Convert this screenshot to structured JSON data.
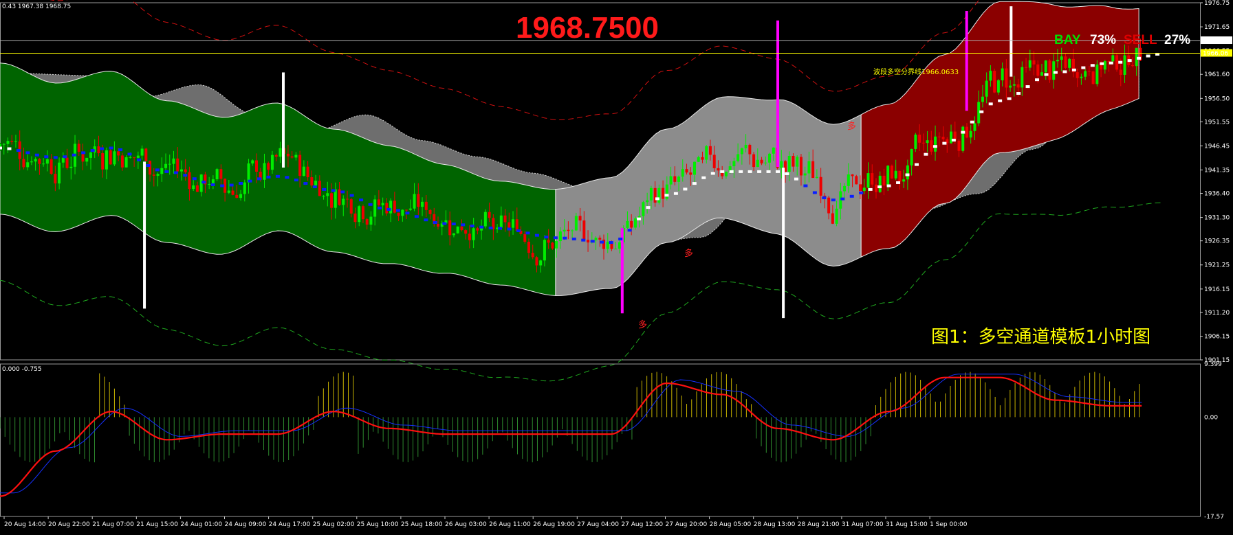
{
  "header": {
    "ohlc_readout": "0.43 1967.38 1968.75",
    "big_price": "1968.7500",
    "caption": "图1：多空通道模板1小时图"
  },
  "sentiment": {
    "bay_label": "BAY",
    "bay_value": "73%",
    "sell_label": "SELL",
    "sell_value": "27%",
    "bay_color": "#00e000",
    "sell_color": "#e00000"
  },
  "dividing_line": {
    "label": "波段多空分界线1966.0633",
    "price": 1966.06,
    "tag": "1966.06",
    "color": "#ffff00"
  },
  "current_price": {
    "price": 1968.75,
    "tag": "1968.75"
  },
  "signal_marks": {
    "text": "多",
    "color": "#ff2020"
  },
  "chart_data": [
    {
      "type": "line",
      "panel": "price",
      "y_axis_labels": [
        "1976.75",
        "1971.65",
        "1966.55",
        "1961.60",
        "1956.50",
        "1951.55",
        "1946.45",
        "1941.35",
        "1936.40",
        "1931.30",
        "1926.35",
        "1921.25",
        "1916.15",
        "1911.20",
        "1906.15",
        "1901.15"
      ],
      "ylim": [
        1901.15,
        1976.75
      ],
      "x_axis_labels": [
        "20 Aug 14:00",
        "20 Aug 22:00",
        "21 Aug 07:00",
        "21 Aug 15:00",
        "24 Aug 01:00",
        "24 Aug 09:00",
        "24 Aug 17:00",
        "25 Aug 02:00",
        "25 Aug 10:00",
        "25 Aug 18:00",
        "26 Aug 03:00",
        "26 Aug 11:00",
        "26 Aug 19:00",
        "27 Aug 04:00",
        "27 Aug 12:00",
        "27 Aug 20:00",
        "28 Aug 05:00",
        "28 Aug 13:00",
        "28 Aug 21:00",
        "31 Aug 07:00",
        "31 Aug 15:00",
        "1 Sep 00:00"
      ],
      "channel_segments": [
        {
          "from": 0,
          "to": 10,
          "color": "#006400"
        },
        {
          "from": 10,
          "to": 15.5,
          "color": "#8c8c8c"
        },
        {
          "from": 15.5,
          "to": 20.5,
          "color": "#8b0000"
        }
      ],
      "channel_center": [
        {
          "x": 0,
          "y": 1948
        },
        {
          "x": 1,
          "y": 1944
        },
        {
          "x": 2,
          "y": 1947
        },
        {
          "x": 3,
          "y": 1941
        },
        {
          "x": 4,
          "y": 1938
        },
        {
          "x": 5,
          "y": 1942
        },
        {
          "x": 6,
          "y": 1937
        },
        {
          "x": 7,
          "y": 1934
        },
        {
          "x": 8,
          "y": 1931
        },
        {
          "x": 9,
          "y": 1928
        },
        {
          "x": 10,
          "y": 1926
        },
        {
          "x": 11,
          "y": 1928
        },
        {
          "x": 12,
          "y": 1938
        },
        {
          "x": 13,
          "y": 1944
        },
        {
          "x": 14,
          "y": 1942
        },
        {
          "x": 15,
          "y": 1936
        },
        {
          "x": 16,
          "y": 1940
        },
        {
          "x": 17,
          "y": 1950
        },
        {
          "x": 18,
          "y": 1961
        },
        {
          "x": 19,
          "y": 1962
        },
        {
          "x": 20,
          "y": 1965
        },
        {
          "x": 21,
          "y": 1967
        }
      ],
      "channel_half_width": [
        {
          "x": 0,
          "y": 16
        },
        {
          "x": 3,
          "y": 15
        },
        {
          "x": 6,
          "y": 13
        },
        {
          "x": 9,
          "y": 11
        },
        {
          "x": 12,
          "y": 12
        },
        {
          "x": 15,
          "y": 15
        },
        {
          "x": 18,
          "y": 16
        },
        {
          "x": 21,
          "y": 9
        }
      ],
      "series": [
        {
          "values": [
            {
              "x": 0,
              "y": 1946
            },
            {
              "x": 1,
              "y": 1944
            },
            {
              "x": 2,
              "y": 1946
            },
            {
              "x": 3,
              "y": 1941
            },
            {
              "x": 4,
              "y": 1938
            },
            {
              "x": 5,
              "y": 1940
            },
            {
              "x": 6,
              "y": 1937
            },
            {
              "x": 7,
              "y": 1933
            },
            {
              "x": 8,
              "y": 1930
            },
            {
              "x": 9,
              "y": 1929
            },
            {
              "x": 10,
              "y": 1927
            },
            {
              "x": 11,
              "y": 1926
            },
            {
              "x": 12,
              "y": 1936
            },
            {
              "x": 13,
              "y": 1941
            },
            {
              "x": 14,
              "y": 1941
            },
            {
              "x": 15,
              "y": 1935
            },
            {
              "x": 16,
              "y": 1938
            },
            {
              "x": 17,
              "y": 1947
            },
            {
              "x": 18,
              "y": 1956
            },
            {
              "x": 19,
              "y": 1962
            },
            {
              "x": 20,
              "y": 1964
            },
            {
              "x": 21,
              "y": 1966
            }
          ]
        }
      ],
      "extreme_bars": [
        {
          "x": 2.6,
          "low": 1912,
          "color": "#ffffff"
        },
        {
          "x": 5.1,
          "high": 1962,
          "color": "#ffffff"
        },
        {
          "x": 11.2,
          "low": 1911,
          "color": "#ff00ff"
        },
        {
          "x": 14.0,
          "high": 1973,
          "color": "#ff00ff"
        },
        {
          "x": 14.1,
          "low": 1910,
          "color": "#ffffff"
        },
        {
          "x": 17.4,
          "high": 1975,
          "color": "#ff00ff"
        },
        {
          "x": 18.2,
          "high": 1976,
          "color": "#ffffff"
        }
      ]
    },
    {
      "type": "bar",
      "panel": "oscillator",
      "header": "0.000 -0.755",
      "y_axis_labels": [
        "9.399",
        "0.00",
        "-17.57"
      ],
      "ylim": [
        -17.57,
        9.399
      ],
      "series": [
        {
          "values": [
            {
              "x": 0,
              "y": -14
            },
            {
              "x": 1,
              "y": -6
            },
            {
              "x": 2,
              "y": 1
            },
            {
              "x": 3,
              "y": -4
            },
            {
              "x": 4,
              "y": -3
            },
            {
              "x": 5,
              "y": -3
            },
            {
              "x": 6,
              "y": 1
            },
            {
              "x": 7,
              "y": -2
            },
            {
              "x": 8,
              "y": -3
            },
            {
              "x": 9,
              "y": -3
            },
            {
              "x": 10,
              "y": -3
            },
            {
              "x": 11,
              "y": -3
            },
            {
              "x": 12,
              "y": 6
            },
            {
              "x": 13,
              "y": 4
            },
            {
              "x": 14,
              "y": -2
            },
            {
              "x": 15,
              "y": -4
            },
            {
              "x": 16,
              "y": 1
            },
            {
              "x": 17,
              "y": 7
            },
            {
              "x": 18,
              "y": 7
            },
            {
              "x": 19,
              "y": 3
            },
            {
              "x": 20,
              "y": 2
            },
            {
              "x": 21,
              "y": 2
            }
          ]
        }
      ]
    }
  ]
}
